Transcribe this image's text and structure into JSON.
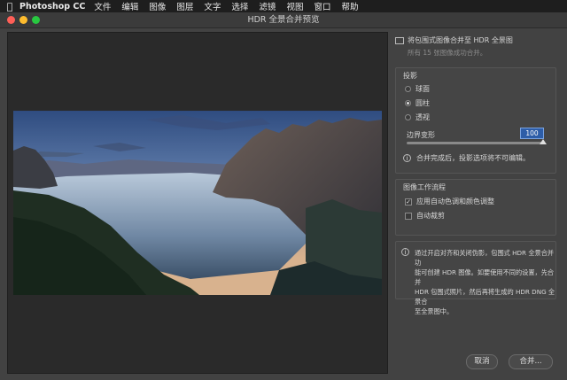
{
  "menubar": {
    "apple": "",
    "app": "Photoshop CC",
    "items": [
      "文件",
      "编辑",
      "图像",
      "图层",
      "文字",
      "选择",
      "滤镜",
      "视图",
      "窗口",
      "帮助"
    ]
  },
  "window": {
    "title": "HDR 全景合并预览"
  },
  "panel": {
    "header_text": "将包围式图像合并至 HDR 全景图",
    "header_sub": "所有 15 张图像成功合并。",
    "projection": {
      "label": "投影",
      "options": [
        "球面",
        "圆柱",
        "透视"
      ],
      "selected": "圆柱",
      "boundary_label": "边界变形",
      "boundary_value": "100",
      "boundary_level": 1.0,
      "note": "合并完成后，投影选项将不可编辑。"
    },
    "workflow": {
      "label": "图像工作流程",
      "auto_tone": "应用自动色调和颜色调整",
      "auto_tone_checked": true,
      "auto_crop": "自动裁剪",
      "auto_crop_checked": false
    },
    "info_lines": [
      "通过开启对齐和关闭伪影，包围式 HDR 全景合并功",
      "能可创建 HDR 图像。如要使用不同的设置，先合并",
      "HDR 包围式照片，然后再将生成的 HDR DNG 全景合",
      "至全景图中。"
    ]
  },
  "buttons": {
    "cancel": "取消",
    "merge": "合并..."
  },
  "colors": {
    "close": "#ff5f57",
    "minimize": "#febc2e",
    "zoom": "#28c840",
    "accent": "#3a78d6"
  }
}
